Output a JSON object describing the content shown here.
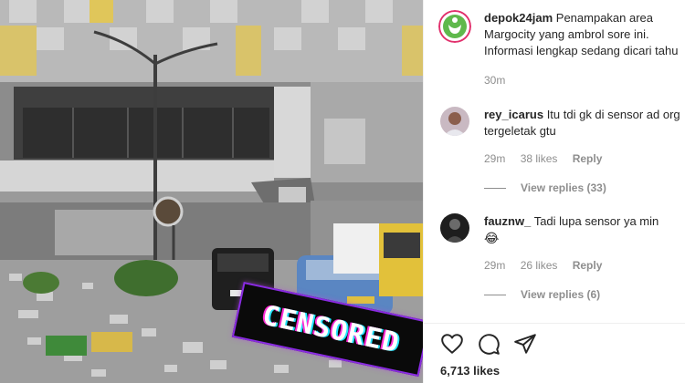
{
  "post": {
    "censored_label": "CENSORED",
    "caption": {
      "username": "depok24jam",
      "text": "Penampakan area Margocity yang ambrol sore ini. Informasi lengkap sedang dicari tahu",
      "time": "30m"
    },
    "comments": [
      {
        "username": "rey_icarus",
        "text": "Itu tdi gk di sensor ad org tergeletak gtu",
        "time": "29m",
        "likes": "38 likes",
        "reply_label": "Reply",
        "view_replies": "View replies (33)"
      },
      {
        "username": "fauznw_",
        "text": "Tadi lupa sensor ya min",
        "emoji": "😂",
        "time": "29m",
        "likes": "26 likes",
        "reply_label": "Reply",
        "view_replies": "View replies (6)"
      }
    ],
    "likes_count": "6,713 likes",
    "icons": [
      "heart-icon",
      "comment-icon",
      "share-icon"
    ],
    "colors": {
      "text": "#262626",
      "secondary": "#8e8e8e",
      "brand_avatar": "#5fb94c"
    }
  }
}
